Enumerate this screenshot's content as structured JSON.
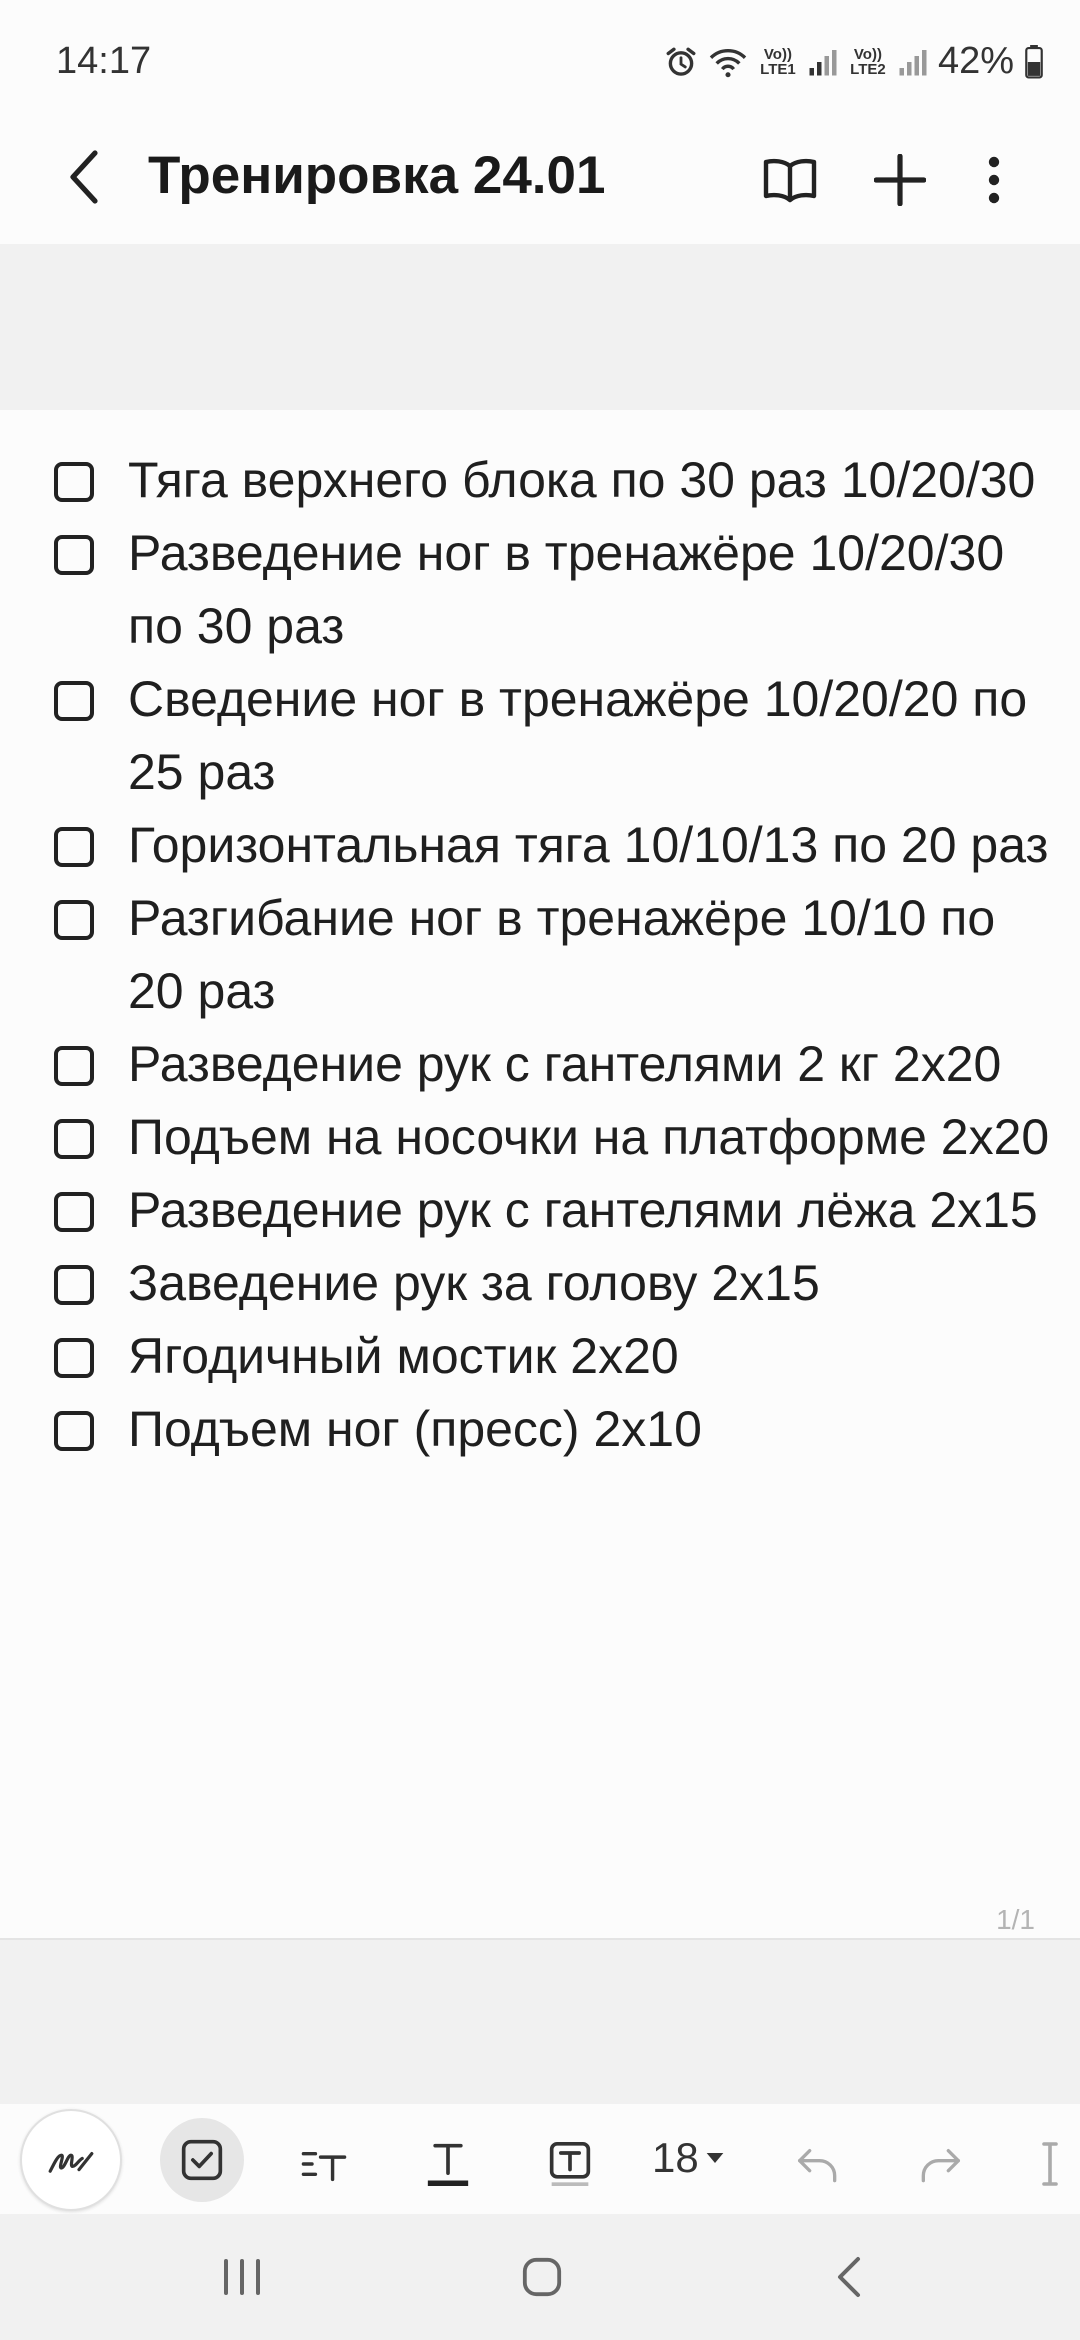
{
  "status": {
    "time": "14:17",
    "net1": "Vo)) LTE1",
    "net2": "Vo)) LTE2",
    "battery": "42%"
  },
  "header": {
    "title": "Тренировка 24.01",
    "icons": [
      "back-icon",
      "book-icon",
      "plus-icon",
      "more-icon"
    ]
  },
  "checklist": [
    {
      "text": "Тяга верхнего блока по 30 раз 10/20/30",
      "checked": false
    },
    {
      "text": "Разведение ног в тренажёре 10/20/30 по 30 раз",
      "checked": false
    },
    {
      "text": "Сведение ног в тренажёре 10/20/20 по 25 раз",
      "checked": false
    },
    {
      "text": "Горизонтальная тяга 10/10/13 по 20 раз",
      "checked": false
    },
    {
      "text": "Разгибание ног в тренажёре 10/10 по 20 раз",
      "checked": false
    },
    {
      "text": "Разведение рук с гантелями 2 кг 2х20",
      "checked": false
    },
    {
      "text": "Подъем на носочки на платформе 2х20",
      "checked": false
    },
    {
      "text": "Разведение рук с гантелями лёжа 2х15",
      "checked": false
    },
    {
      "text": "Заведение рук за голову 2х15",
      "checked": false
    },
    {
      "text": "Ягодичный мостик 2х20",
      "checked": false
    },
    {
      "text": "Подъем ног (пресс) 2х10",
      "checked": false
    }
  ],
  "page_counter": "1/1",
  "toolbar": {
    "font_size": "18",
    "icons": [
      "handwriting-icon",
      "checklist-icon",
      "text-format-icon",
      "text-color-icon",
      "text-box-icon",
      "undo-icon",
      "redo-icon"
    ]
  },
  "navbar": {
    "icons": [
      "recents-icon",
      "home-icon",
      "nav-back-icon"
    ]
  }
}
